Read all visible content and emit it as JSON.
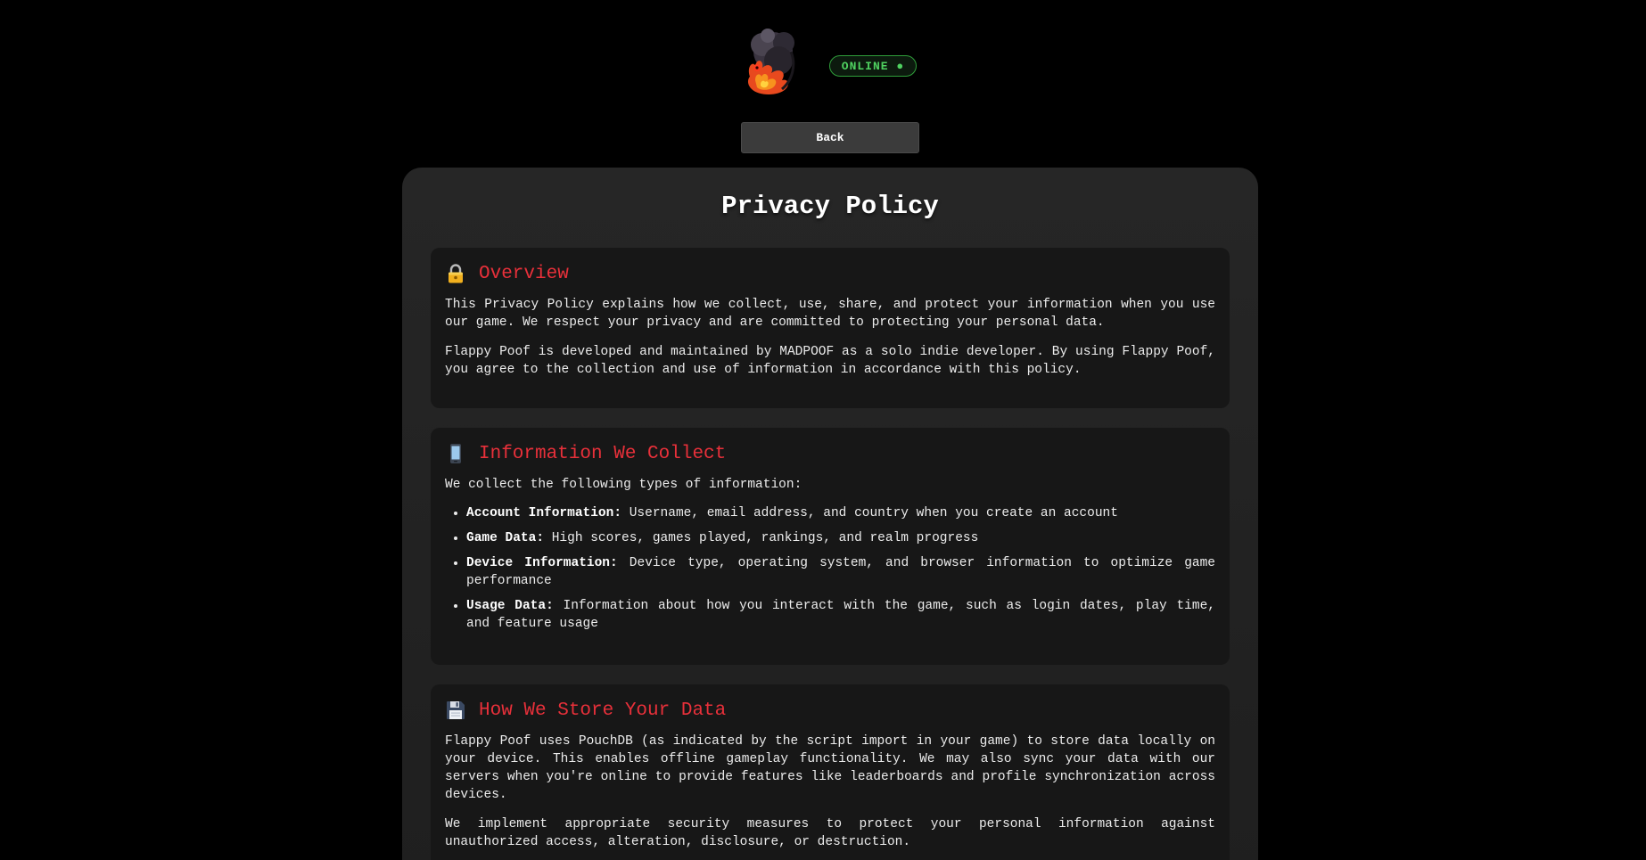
{
  "header": {
    "logo_name": "flame-skull-logo",
    "status": "ONLINE ●",
    "back_label": "Back"
  },
  "page_title": "Privacy Policy",
  "sections": {
    "overview": {
      "icon": "lock-icon",
      "title": "Overview",
      "paragraphs": [
        "This Privacy Policy explains how we collect, use, share, and protect your information when you use our game. We respect your privacy and are committed to protecting your personal data.",
        "Flappy Poof is developed and maintained by MADPOOF as a solo indie developer. By using Flappy Poof, you agree to the collection and use of information in accordance with this policy."
      ]
    },
    "collect": {
      "icon": "mobile-phone-icon",
      "title": "Information We Collect",
      "intro": "We collect the following types of information:",
      "items": [
        {
          "label": "Account Information:",
          "text": " Username, email address, and country when you create an account"
        },
        {
          "label": "Game Data:",
          "text": " High scores, games played, rankings, and realm progress"
        },
        {
          "label": "Device Information:",
          "text": " Device type, operating system, and browser information to optimize game performance"
        },
        {
          "label": "Usage Data:",
          "text": " Information about how you interact with the game, such as login dates, play time, and feature usage"
        }
      ]
    },
    "storage": {
      "icon": "floppy-disk-icon",
      "title": "How We Store Your Data",
      "paragraphs": [
        "Flappy Poof uses PouchDB (as indicated by the script import in your game) to store data locally on your device. This enables offline gameplay functionality. We may also sync your data with our servers when you're online to provide features like leaderboards and profile synchronization across devices.",
        "We implement appropriate security measures to protect your personal information against unauthorized access, alteration, disclosure, or destruction."
      ]
    }
  },
  "colors": {
    "accent": "#e8303a",
    "online": "#4fd160",
    "background": "#000000",
    "panel": "#242424",
    "section": "#171717"
  }
}
